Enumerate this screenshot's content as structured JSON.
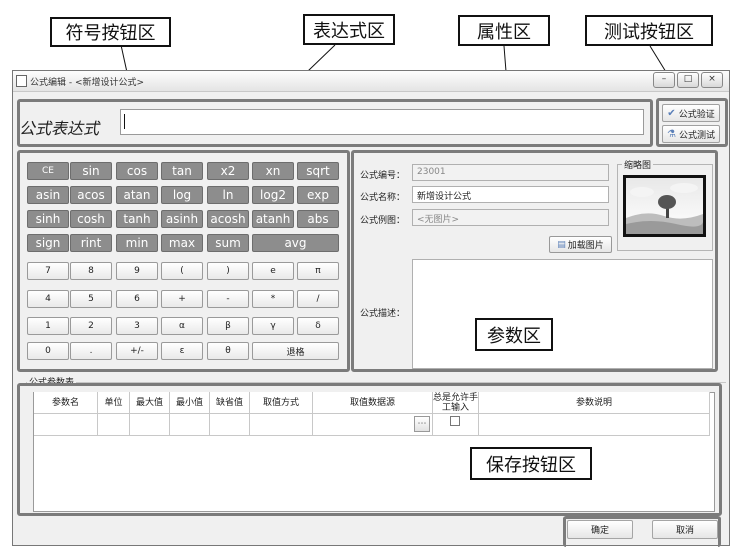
{
  "callouts": {
    "symbol_area": "符号按钮区",
    "expression_area": "表达式区",
    "property_area": "属性区",
    "test_area": "测试按钮区",
    "param_area": "参数区",
    "save_area": "保存按钮区"
  },
  "window": {
    "title": "公式编辑 - <新增设计公式>",
    "controls": [
      "–",
      "□",
      "×"
    ]
  },
  "expression": {
    "label": "公式表达式",
    "value": ""
  },
  "test_buttons": {
    "verify": "公式验证",
    "test": "公式测试"
  },
  "keypad": {
    "function_rows": [
      [
        "CE",
        "sin",
        "cos",
        "tan",
        "x2",
        "xn",
        "sqrt"
      ],
      [
        "asin",
        "acos",
        "atan",
        "log",
        "ln",
        "log2",
        "exp"
      ],
      [
        "sinh",
        "cosh",
        "tanh",
        "asinh",
        "acosh",
        "atanh",
        "abs"
      ],
      [
        "sign",
        "rint",
        "min",
        "max",
        "sum",
        "avg"
      ]
    ],
    "number_rows": [
      [
        "7",
        "8",
        "9",
        "(",
        ")",
        "e",
        "π"
      ],
      [
        "4",
        "5",
        "6",
        "+",
        "-",
        "*",
        "/"
      ],
      [
        "1",
        "2",
        "3",
        "α",
        "β",
        "γ",
        "δ"
      ],
      [
        "0",
        ".",
        "+/-",
        "ε",
        "θ",
        "退格"
      ]
    ]
  },
  "properties": {
    "code_label": "公式编号：",
    "code_value": "23001",
    "name_label": "公式名称：",
    "name_value": "新增设计公式",
    "example_label": "公式例图：",
    "example_value": "<无图片>",
    "load_button": "加载图片",
    "thumbnail_label": "缩略图",
    "desc_label": "公式描述：",
    "desc_value": ""
  },
  "params": {
    "group_label": "公式参数表",
    "columns": [
      "参数名",
      "单位",
      "最大值",
      "最小值",
      "缺省值",
      "取值方式",
      "取值数据源",
      "总是允许手工输入",
      "参数说明"
    ]
  },
  "footer": {
    "ok": "确定",
    "cancel": "取消"
  }
}
